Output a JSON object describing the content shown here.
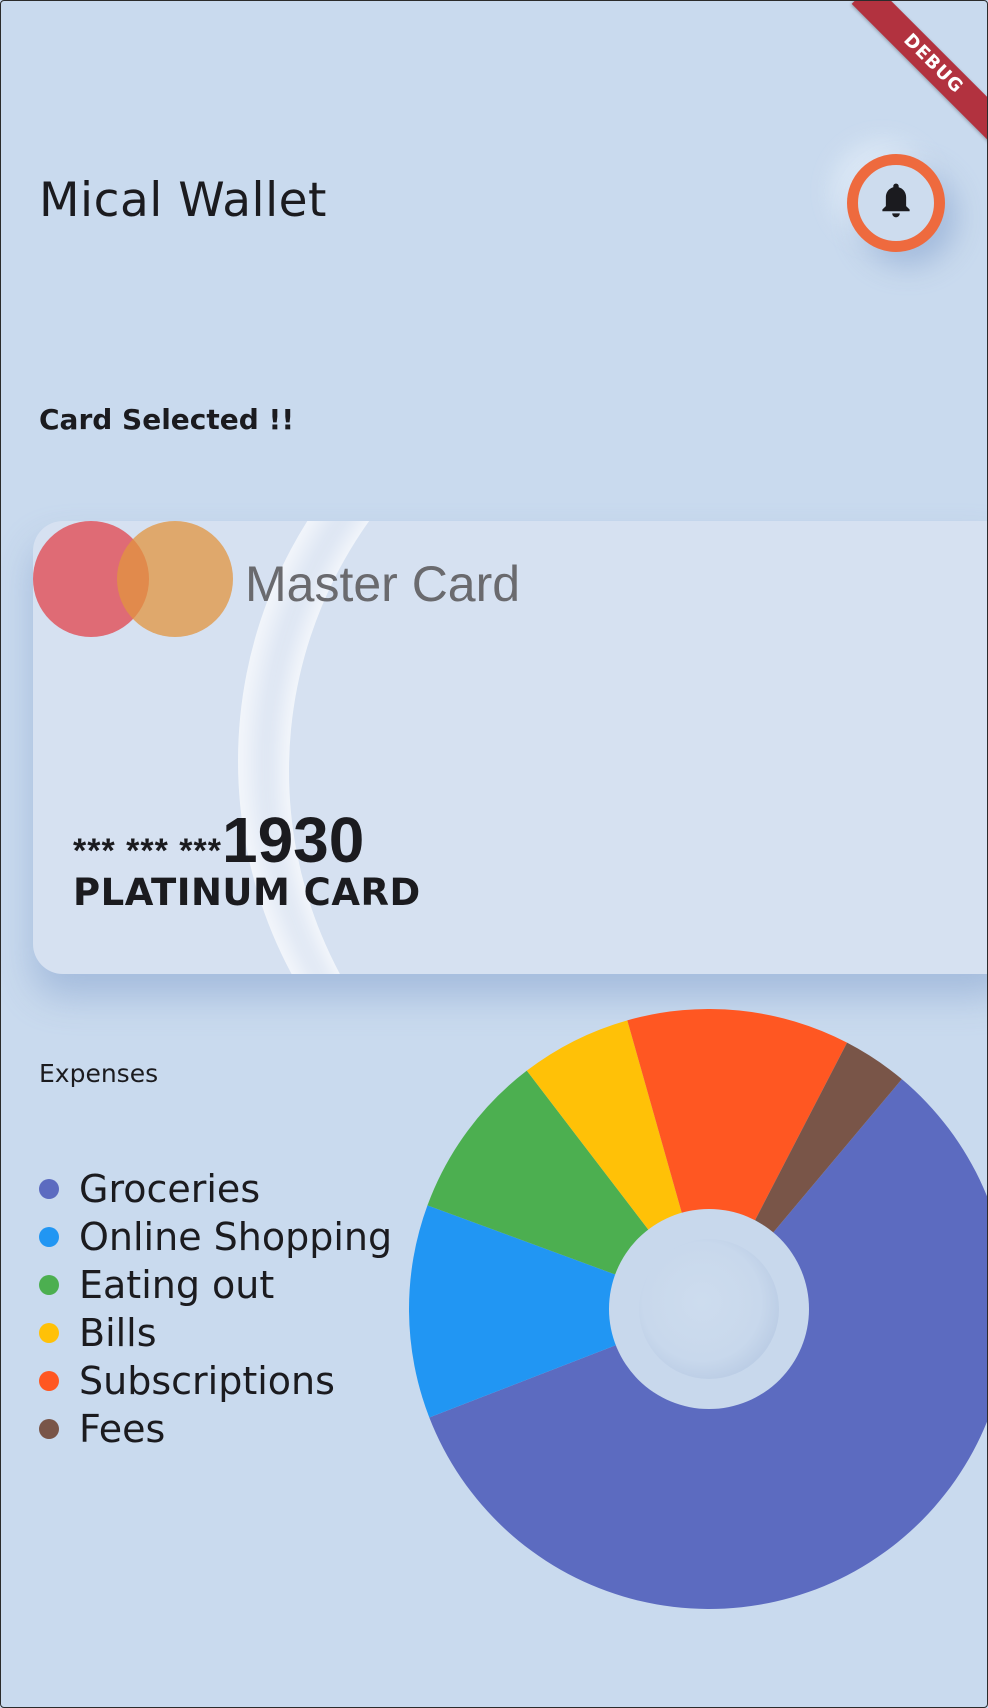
{
  "app": {
    "title": "Mical Wallet",
    "debug_banner": "DEBUG",
    "notification_icon": "bell-icon"
  },
  "card_section": {
    "label": "Card Selected !!"
  },
  "card": {
    "brand": "Master Card",
    "number_mask": "*** *** ***",
    "last4": "1930",
    "type": "PLATINUM CARD",
    "logo_colors": [
      "#e0565f",
      "#e2943f"
    ]
  },
  "expenses": {
    "label": "Expenses",
    "legend": [
      {
        "name": "Groceries",
        "color": "#5c6bc0"
      },
      {
        "name": "Online Shopping",
        "color": "#2196f3"
      },
      {
        "name": "Eating out",
        "color": "#4caf50"
      },
      {
        "name": "Bills",
        "color": "#ffc107"
      },
      {
        "name": "Subscriptions",
        "color": "#ff5722"
      },
      {
        "name": "Fees",
        "color": "#795548"
      }
    ]
  },
  "chart_data": {
    "type": "pie",
    "donut": true,
    "categories": [
      "Groceries",
      "Online Shopping",
      "Eating out",
      "Bills",
      "Subscriptions",
      "Fees"
    ],
    "values": [
      58,
      11.5,
      9,
      6,
      12,
      3.5
    ],
    "colors": [
      "#5c6bc0",
      "#2196f3",
      "#4caf50",
      "#ffc107",
      "#ff5722",
      "#795548"
    ],
    "start_angle_deg": 40
  }
}
